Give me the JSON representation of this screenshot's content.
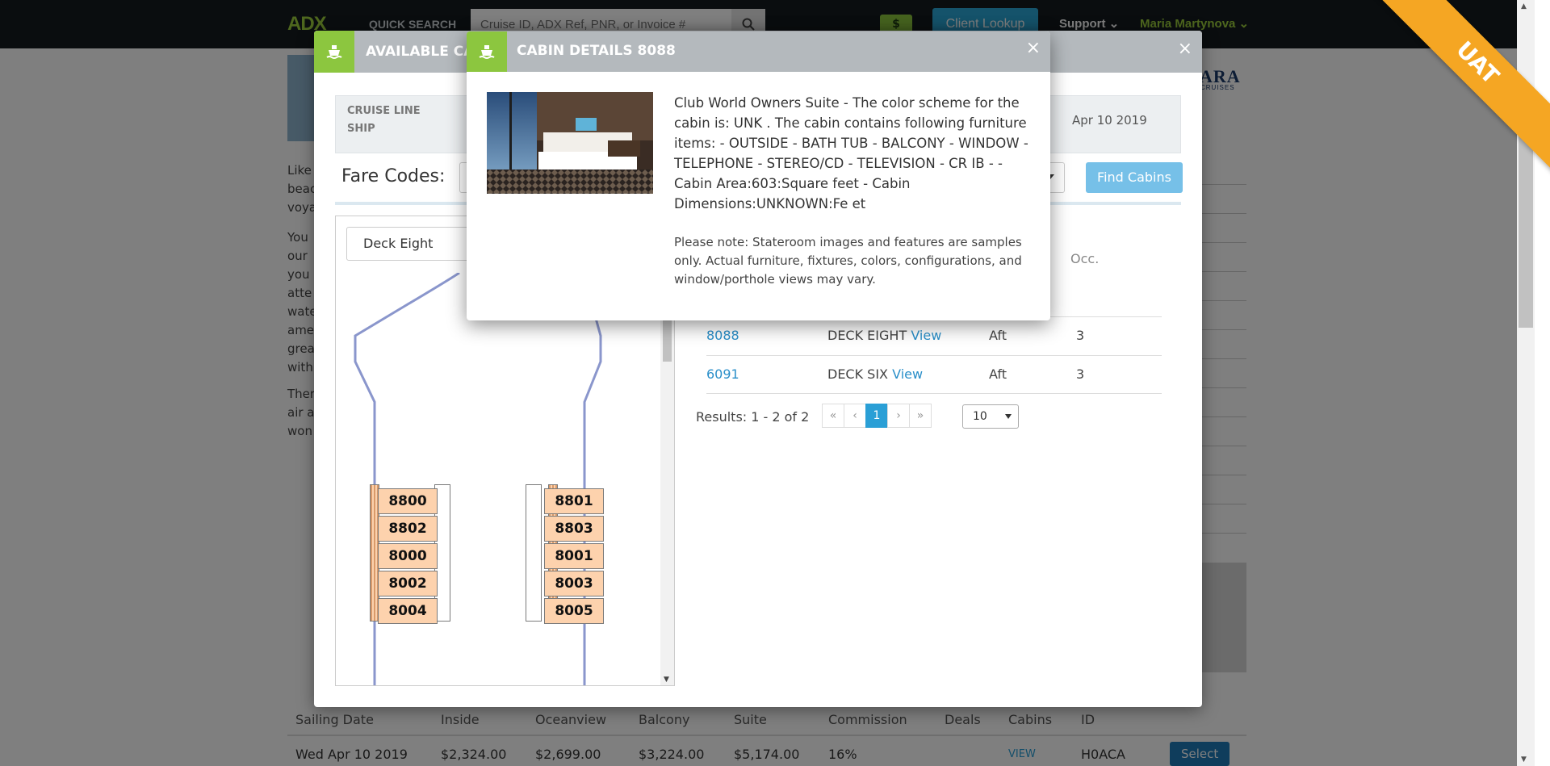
{
  "topbar": {
    "logo": "ADX",
    "quick_search_label": "QUICK SEARCH",
    "search_placeholder": "Cruise ID, ADX Ref, PNR, or Invoice #",
    "dollar_label": "$",
    "client_lookup": "Client Lookup",
    "support": "Support",
    "user_name": "Maria Martynova"
  },
  "background": {
    "brand": "ARA",
    "brand_sub": "CRUISES",
    "text_fragments": [
      "Like",
      "beac",
      "voya",
      "You",
      "our",
      "you",
      "atte",
      "wate",
      "ame",
      "grea",
      "with",
      "Ther",
      "air a",
      "won"
    ],
    "sailing_table": {
      "headers": [
        "Sailing Date",
        "Inside",
        "Oceanview",
        "Balcony",
        "Suite",
        "Commission",
        "Deals",
        "Cabins",
        "ID"
      ],
      "row": {
        "date": "Wed Apr 10 2019",
        "inside": "$2,324.00",
        "oceanview": "$2,699.00",
        "balcony": "$3,224.00",
        "suite": "$5,174.00",
        "commission": "16%",
        "cabins": "VIEW",
        "id": "H0ACA",
        "select": "Select"
      }
    }
  },
  "available_cabins_modal": {
    "title": "AVAILABLE CABINS",
    "close": "×",
    "info": {
      "cruise_line_label": "CRUISE LINE",
      "ship_label": "SHIP",
      "date": "Apr 10 2019"
    },
    "fare_codes_label": "Fare Codes:",
    "find_cabins": "Find Cabins",
    "deck_select": "Deck Eight",
    "deck_plan_cabins": [
      "8800",
      "8802",
      "8000",
      "8002",
      "8004",
      "8801",
      "8803",
      "8001",
      "8003",
      "8005"
    ],
    "occ_header": "Occ.",
    "rows": [
      {
        "cabin": "8088",
        "deck": "DECK EIGHT",
        "view": "View",
        "location": "Aft",
        "occ": "3"
      },
      {
        "cabin": "6091",
        "deck": "DECK SIX",
        "view": "View",
        "location": "Aft",
        "occ": "3"
      }
    ],
    "results_label": "Results: 1 - 2 of 2",
    "pager": [
      "«",
      "‹",
      "1",
      "›",
      "»"
    ],
    "page_size": "10"
  },
  "cabin_details_modal": {
    "title": "CABIN DETAILS 8088",
    "close": "×",
    "description": "Club World Owners Suite - The color scheme for the cabin is: UNK . The cabin contains following furniture items: - OUTSIDE - BATH TUB - BALCONY - WINDOW - TELEPHONE - STEREO/CD - TELEVISION - CR IB - - Cabin Area:603:Square feet - Cabin Dimensions:UNKNOWN:Fe et",
    "note": "Please note: Stateroom images and features are samples only. Actual furniture, fixtures, colors, configurations, and window/porthole views may vary."
  },
  "ribbon": "UAT",
  "colors": {
    "accent_green": "#8cc63f",
    "header_grey": "#b4b9bd",
    "link_blue": "#2a8fc9",
    "ribbon_orange": "#f5a623"
  }
}
